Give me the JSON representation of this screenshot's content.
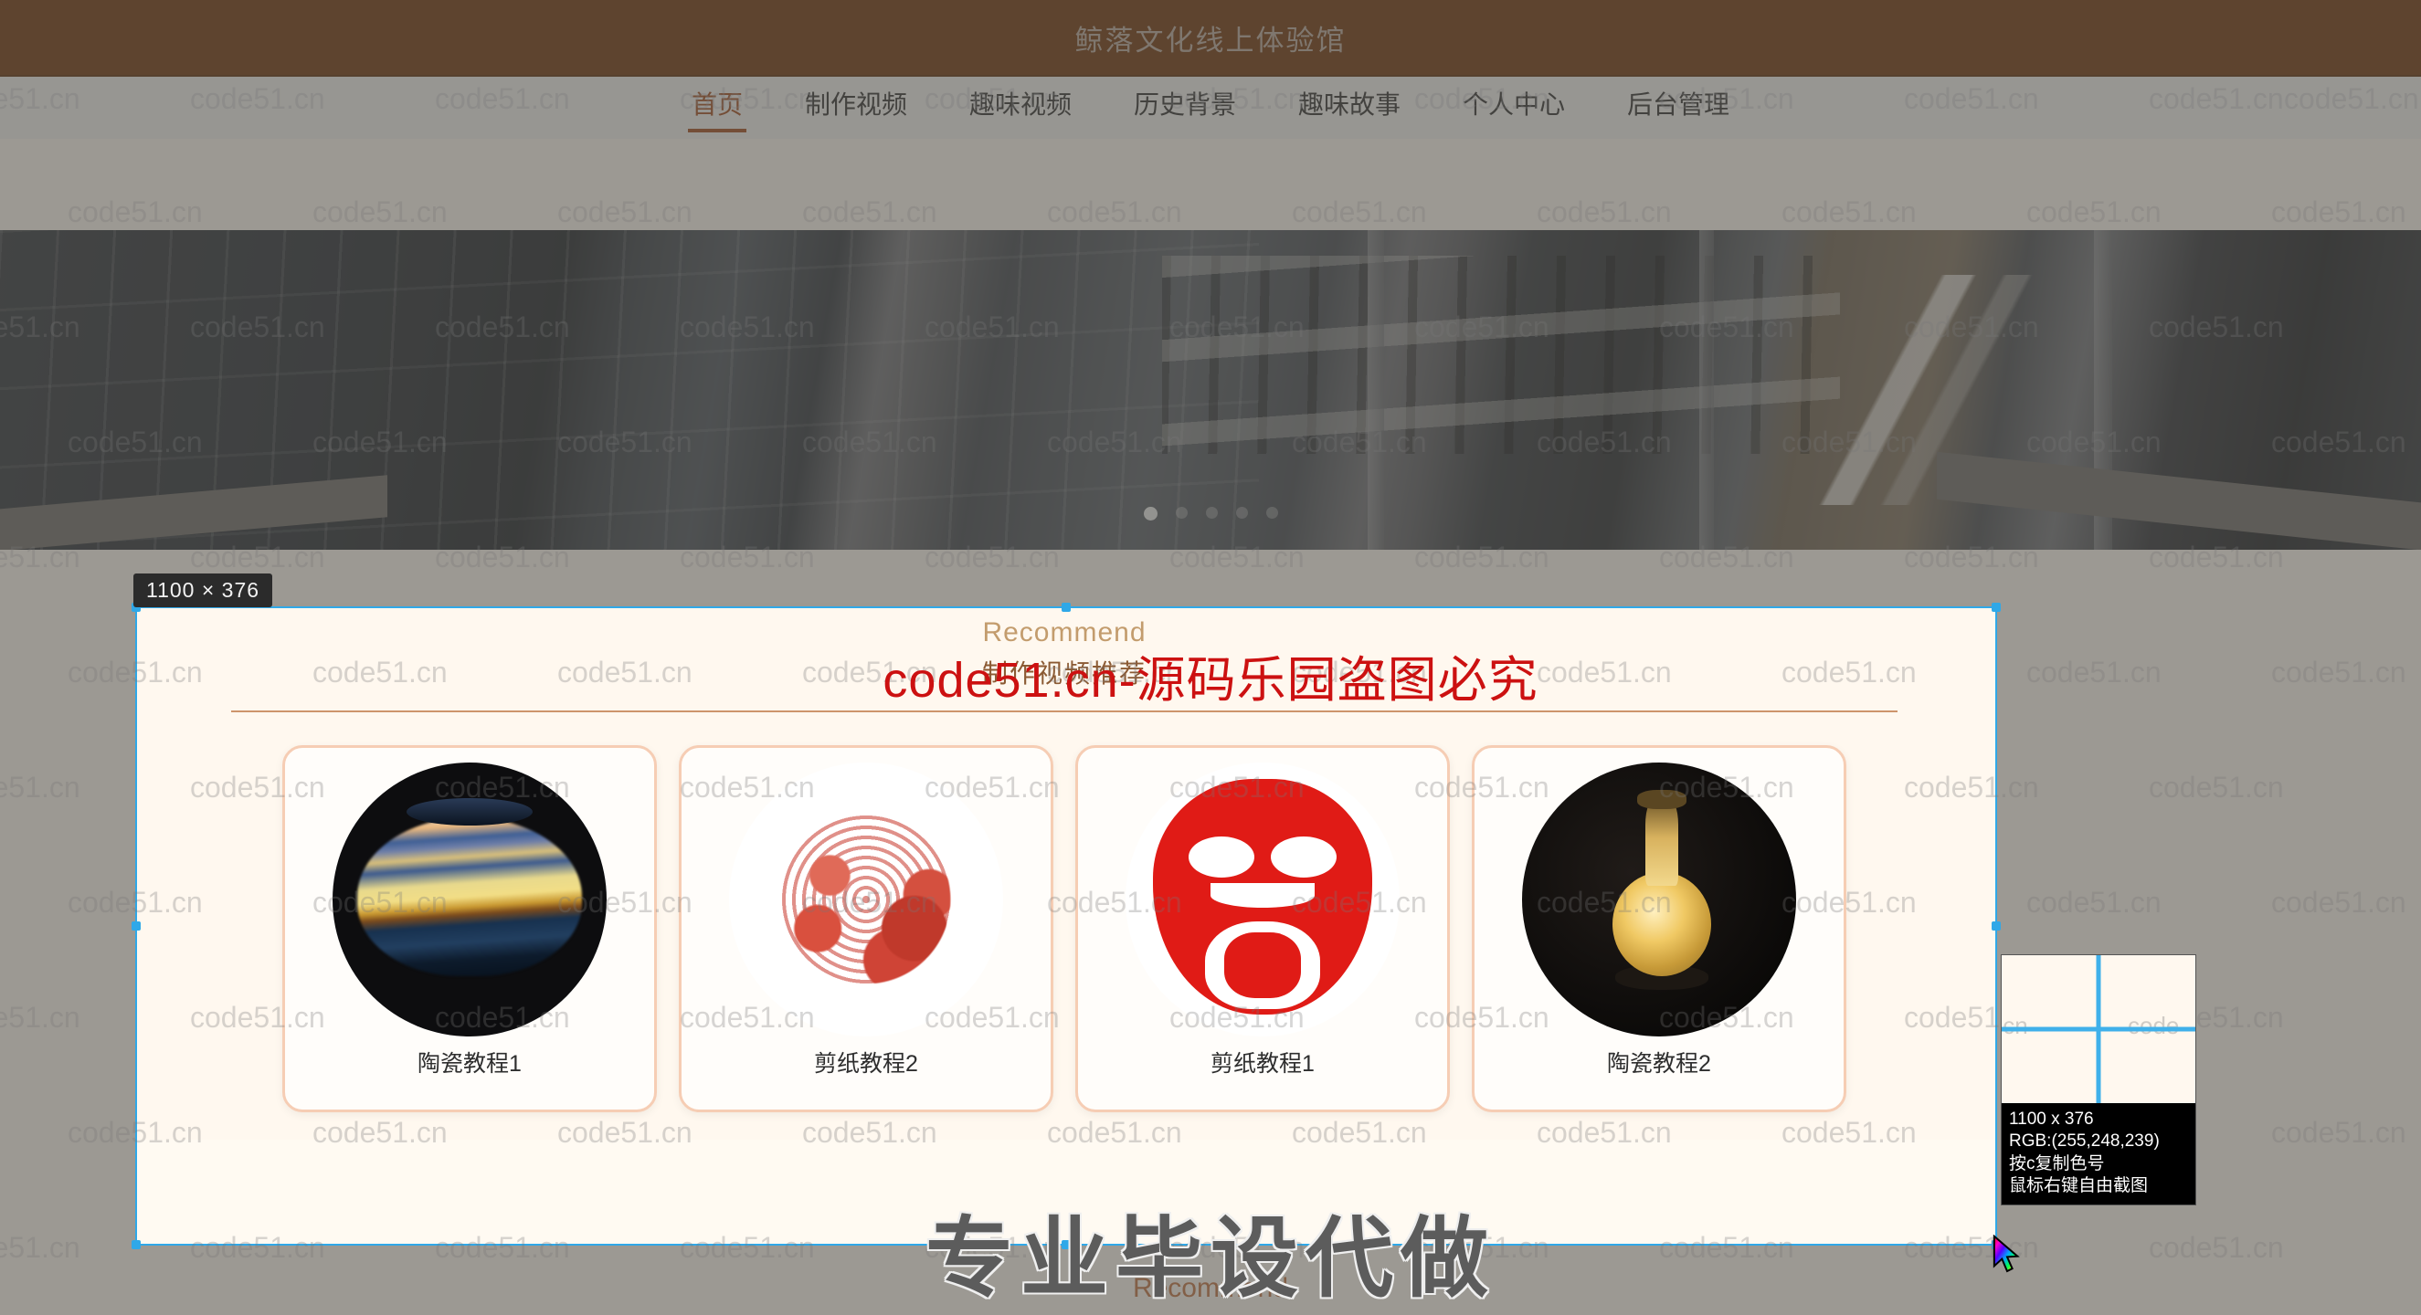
{
  "site": {
    "title": "鲸落文化线上体验馆",
    "nav": [
      {
        "label": "首页",
        "active": true
      },
      {
        "label": "制作视频",
        "active": false
      },
      {
        "label": "趣味视频",
        "active": false
      },
      {
        "label": "历史背景",
        "active": false
      },
      {
        "label": "趣味故事",
        "active": false
      },
      {
        "label": "个人中心",
        "active": false
      },
      {
        "label": "后台管理",
        "active": false
      }
    ]
  },
  "carousel": {
    "dot_count": 5,
    "active_index": 0
  },
  "recommend": {
    "heading_en": "Recommend",
    "heading_cn": "制作视频推荐",
    "heading_en_bottom": "Recommend",
    "cards": [
      {
        "label": "陶瓷教程1",
        "art": "ceramic-vase-sunset"
      },
      {
        "label": "剪纸教程2",
        "art": "papercut-peacock"
      },
      {
        "label": "剪纸教程1",
        "art": "papercut-lion-face"
      },
      {
        "label": "陶瓷教程2",
        "art": "ceramic-vase-gold"
      }
    ]
  },
  "watermark": {
    "tile_text": "code51.cn",
    "red_notice": "code51.cn-源码乐园盗图必究",
    "big_text": "专业毕设代做"
  },
  "capture_tool": {
    "size_badge": "1100 × 376",
    "magnifier": {
      "size": "1100 x 376",
      "rgb": "RGB:(255,248,239)",
      "hint_copy": "按c复制色号",
      "hint_right_click": "鼠标右键自由截图",
      "sample_wm_left": ".cn",
      "sample_wm_right": "code"
    },
    "selection_color": "#2fa8e8"
  },
  "colors": {
    "topbar": "#6d3106",
    "accent": "#a0481a",
    "card_border": "#f6cdb4",
    "section_bg": "#fff8ef",
    "picked_rgb": "rgb(255,248,239)"
  }
}
